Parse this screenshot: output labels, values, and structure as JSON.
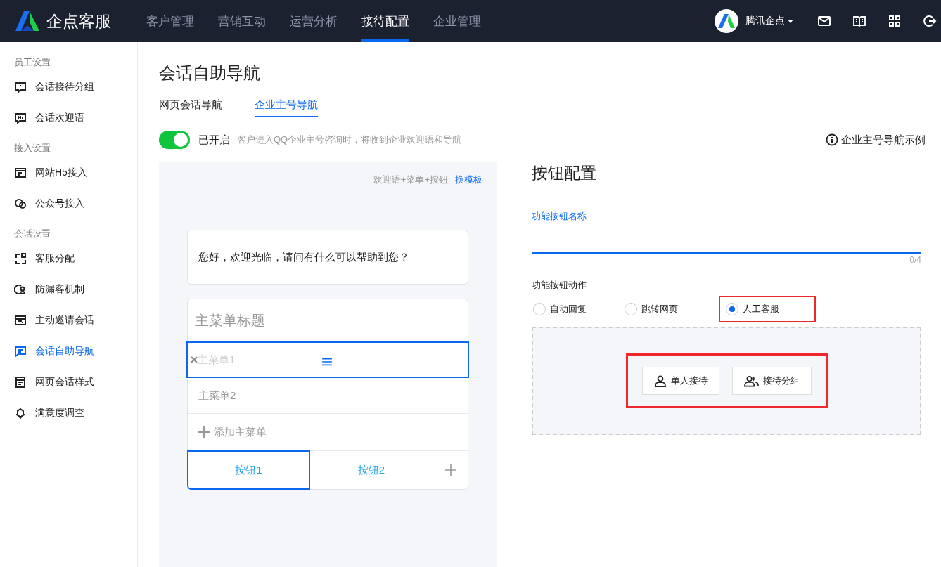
{
  "header": {
    "logo": "企点客服",
    "nav": [
      {
        "label": "客户管理",
        "selected": false
      },
      {
        "label": "营销互动",
        "selected": false
      },
      {
        "label": "运营分析",
        "selected": false
      },
      {
        "label": "接待配置",
        "selected": true
      },
      {
        "label": "企业管理",
        "selected": false
      }
    ],
    "account": {
      "name": "腾讯企点"
    }
  },
  "sidebar": {
    "groups": [
      {
        "title": "员工设置",
        "items": [
          {
            "label": "会话接待分组",
            "selected": false
          },
          {
            "label": "会话欢迎语",
            "selected": false
          }
        ]
      },
      {
        "title": "接入设置",
        "items": [
          {
            "label": "网站H5接入",
            "selected": false
          },
          {
            "label": "公众号接入",
            "selected": false
          }
        ]
      },
      {
        "title": "会话设置",
        "items": [
          {
            "label": "客服分配",
            "selected": false
          },
          {
            "label": "防漏客机制",
            "selected": false
          },
          {
            "label": "主动邀请会话",
            "selected": false
          },
          {
            "label": "会话自助导航",
            "selected": true
          },
          {
            "label": "网页会话样式",
            "selected": false
          },
          {
            "label": "满意度调查",
            "selected": false
          }
        ]
      }
    ]
  },
  "page": {
    "title": "会话自助导航",
    "tabs": [
      {
        "label": "网页会话导航",
        "selected": false
      },
      {
        "label": "企业主号导航",
        "selected": true
      }
    ],
    "toggle": {
      "on": true,
      "label": "已开启",
      "hint": "客户进入QQ企业主号咨询时，将收到企业欢迎语和导航"
    },
    "example_link": "企业主号导航示例"
  },
  "preview": {
    "template": "欢迎语+菜单+按钮",
    "switch_template": "换模板",
    "welcome": "您好，欢迎光临，请问有什么可以帮助到您？",
    "menu_title": "主菜单标题",
    "menu_items": [
      {
        "label": "主菜单1",
        "dragging": true
      },
      {
        "label": "主菜单2",
        "dragging": false
      }
    ],
    "add_menu": "添加主菜单",
    "buttons": [
      {
        "label": "按钮1",
        "selected": true
      },
      {
        "label": "按钮2",
        "selected": false
      }
    ]
  },
  "config": {
    "title": "按钮配置",
    "name_field": {
      "label": "功能按钮名称",
      "counter": "0/4"
    },
    "action": {
      "label": "功能按钮动作",
      "options": [
        {
          "label": "自动回复",
          "selected": false,
          "highlighted": false
        },
        {
          "label": "跳转网页",
          "selected": false,
          "highlighted": false
        },
        {
          "label": "人工客服",
          "selected": true,
          "highlighted": true
        }
      ]
    },
    "handoff": {
      "highlighted": true,
      "buttons": [
        {
          "label": "单人接待",
          "kind": "single"
        },
        {
          "label": "接待分组",
          "kind": "group"
        }
      ]
    }
  }
}
